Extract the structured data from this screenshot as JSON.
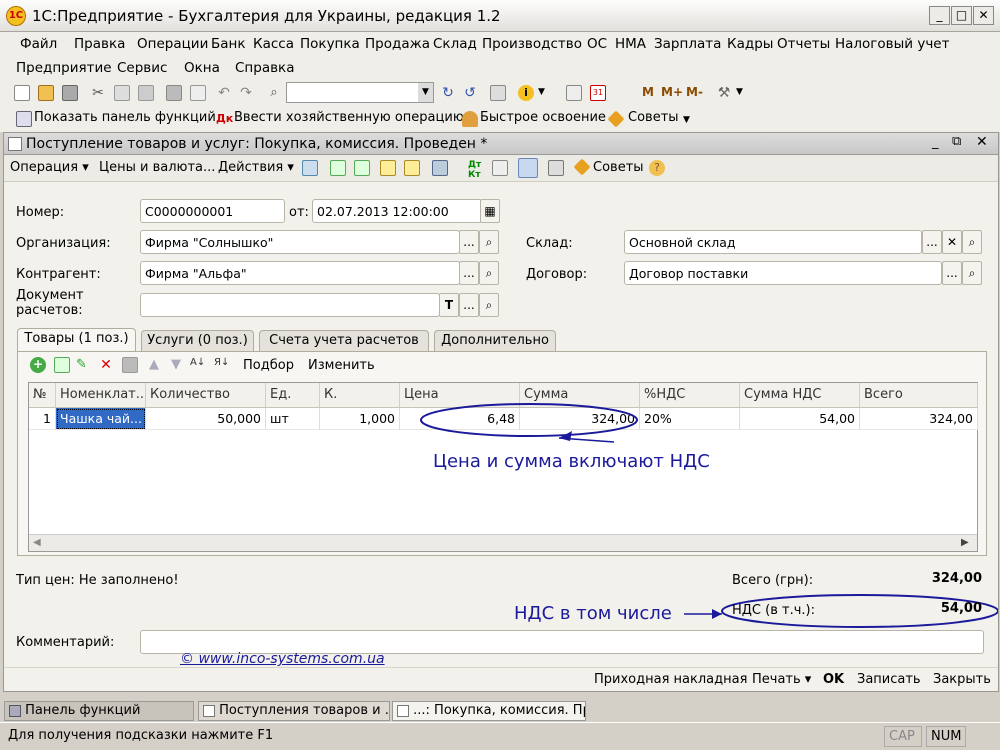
{
  "window": {
    "title": "1С:Предприятие - Бухгалтерия для Украины, редакция 1.2",
    "app_icon": "1C"
  },
  "menu1": [
    "Файл",
    "Правка",
    "Операции",
    "Банк",
    "Касса",
    "Покупка",
    "Продажа",
    "Склад",
    "Производство",
    "ОС",
    "НМА",
    "Зарплата",
    "Кадры",
    "Отчеты",
    "Налоговый учет"
  ],
  "menu2": [
    "Предприятие",
    "Сервис",
    "Окна",
    "Справка"
  ],
  "toolbar2": {
    "m": "M",
    "mplus": "M+",
    "mminus": "M-"
  },
  "toolbar3": {
    "panel": "Показать панель функций",
    "enter_op": "Ввести хозяйственную операцию",
    "quick": "Быстрое освоение",
    "tips": "Советы"
  },
  "doc": {
    "title": "Поступление товаров и услуг: Покупка, комиссия. Проведен *",
    "toolbar": {
      "operation": "Операция",
      "prices": "Цены и валюта...",
      "actions": "Действия",
      "tips": "Советы"
    },
    "labels": {
      "number": "Номер:",
      "from": "от:",
      "org": "Организация:",
      "warehouse": "Склад:",
      "counterparty": "Контрагент:",
      "contract": "Договор:",
      "settlement_doc": "Документ\nрасчетов:"
    },
    "values": {
      "number": "С0000000001",
      "date": "02.07.2013 12:00:00",
      "org": "Фирма \"Солнышко\"",
      "warehouse": "Основной склад",
      "counterparty": "Фирма \"Альфа\"",
      "contract": "Договор поставки",
      "settlement_doc": ""
    },
    "tabs": [
      "Товары (1 поз.)",
      "Услуги (0 поз.)",
      "Счета учета расчетов",
      "Дополнительно"
    ],
    "grid_toolbar": {
      "selection": "Подбор",
      "change": "Изменить"
    },
    "columns": [
      "№",
      "Номенклат...",
      "Количество",
      "Ед.",
      "К.",
      "Цена",
      "Сумма",
      "%НДС",
      "Сумма НДС",
      "Всего"
    ],
    "rows": [
      [
        "1",
        "Чашка чай...",
        "50,000",
        "шт",
        "1,000",
        "6,48",
        "324,00",
        "20%",
        "54,00",
        "324,00"
      ]
    ],
    "annotation1": "Цена и сумма включают НДС",
    "annotation2": "НДС в том числе",
    "price_type": "Тип цен: Не заполнено!",
    "total_label": "Всего (грн):",
    "total_value": "324,00",
    "vat_label": "НДС (в т.ч.):",
    "vat_value": "54,00",
    "comment_label": "Комментарий:",
    "comment_value": "",
    "watermark": "© www.inco-systems.com.ua",
    "bottom": {
      "invoice": "Приходная накладная",
      "print": "Печать",
      "ok": "OK",
      "save": "Записать",
      "close": "Закрыть"
    }
  },
  "taskbar": [
    "Панель функций",
    "Поступления товаров и ...",
    "...: Покупка, комиссия. Пр..."
  ],
  "status": {
    "hint": "Для получения подсказки нажмите F1",
    "cap": "CAP",
    "num": "NUM"
  },
  "colors": {
    "annotation": "#1a1a9a",
    "selection": "#316ac5"
  }
}
